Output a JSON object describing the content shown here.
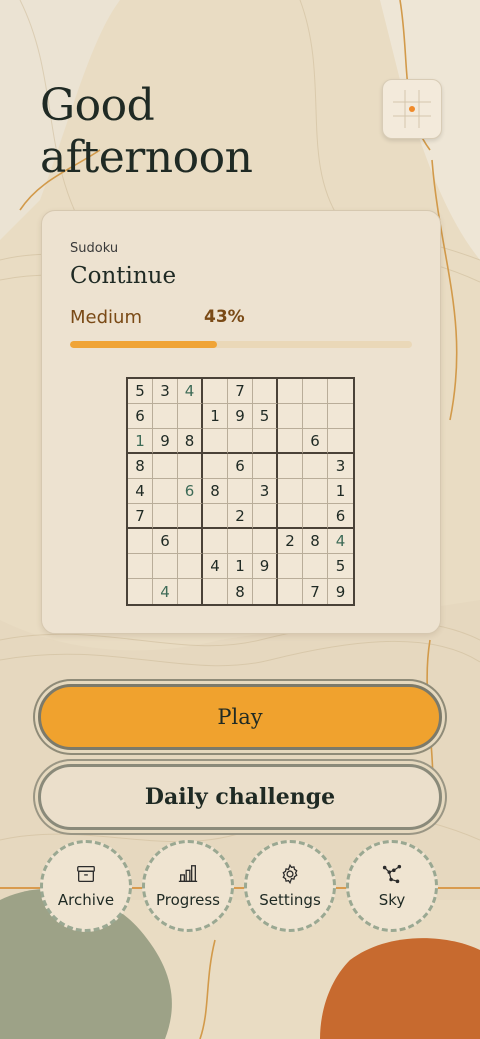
{
  "greeting": "Good\nafternoon",
  "card": {
    "kicker": "Sudoku",
    "title": "Continue",
    "difficulty": "Medium",
    "progress_text": "43%",
    "progress": 0.43
  },
  "board": [
    [
      "5",
      "3",
      "4",
      "",
      "7",
      "",
      "",
      "",
      ""
    ],
    [
      "6",
      "",
      "",
      "1",
      "9",
      "5",
      "",
      "",
      ""
    ],
    [
      "1",
      "9",
      "8",
      "",
      "",
      "",
      "",
      "6",
      ""
    ],
    [
      "8",
      "",
      "",
      "",
      "6",
      "",
      "",
      "",
      "3"
    ],
    [
      "4",
      "",
      "6",
      "8",
      "",
      "3",
      "",
      "",
      "1"
    ],
    [
      "7",
      "",
      "",
      "",
      "2",
      "",
      "",
      "",
      "6"
    ],
    [
      "",
      "6",
      "",
      "",
      "",
      "",
      "2",
      "8",
      "4"
    ],
    [
      "",
      "",
      "",
      "4",
      "1",
      "9",
      "",
      "",
      "5"
    ],
    [
      "",
      "4",
      "",
      "",
      "8",
      "",
      "",
      "7",
      "9"
    ]
  ],
  "user_filled": [
    [
      0,
      2
    ],
    [
      2,
      0
    ],
    [
      4,
      2
    ],
    [
      6,
      8
    ],
    [
      8,
      1
    ]
  ],
  "buttons": {
    "play": "Play",
    "daily": "Daily challenge"
  },
  "nav": [
    {
      "label": "Archive",
      "icon": "archive-icon"
    },
    {
      "label": "Progress",
      "icon": "bar-chart-icon"
    },
    {
      "label": "Settings",
      "icon": "gear-icon"
    },
    {
      "label": "Sky",
      "icon": "constellation-icon"
    }
  ],
  "colors": {
    "accent": "#f0a436",
    "background": "#e9dcc3",
    "text": "#1f2a24",
    "difficulty": "#7a4a16"
  }
}
